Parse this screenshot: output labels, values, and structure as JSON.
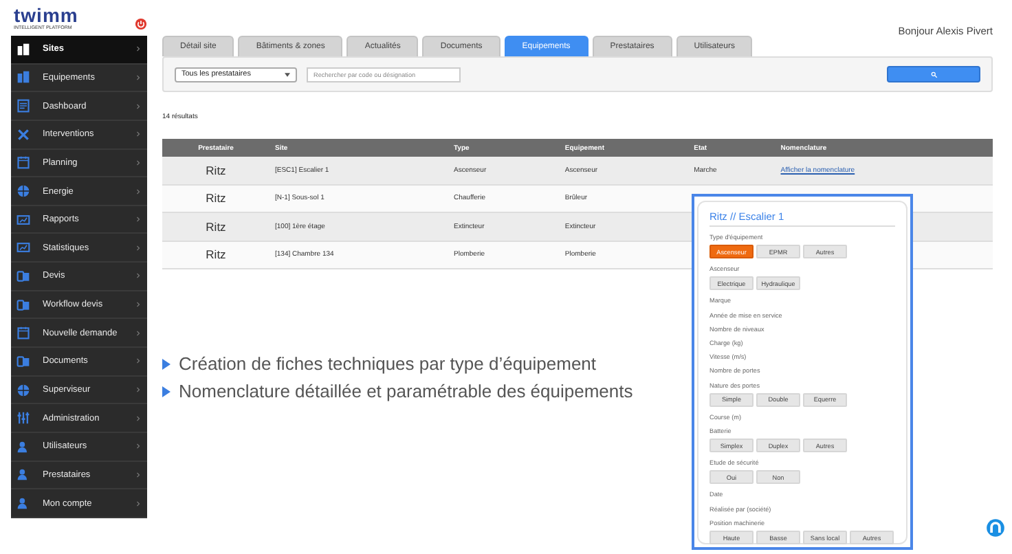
{
  "logo": {
    "name": "twimm",
    "tagline": "INTELLIGENT PLATFORM"
  },
  "sidebar": {
    "items": [
      {
        "label": "Sites",
        "selected": true
      },
      {
        "label": "Equipements",
        "selected": false
      },
      {
        "label": "Dashboard",
        "selected": false
      },
      {
        "label": "Interventions",
        "selected": false
      },
      {
        "label": "Planning",
        "selected": false
      },
      {
        "label": "Energie",
        "selected": false
      },
      {
        "label": "Rapports",
        "selected": false
      },
      {
        "label": "Statistiques",
        "selected": false
      },
      {
        "label": "Devis",
        "selected": false
      },
      {
        "label": "Workflow devis",
        "selected": false
      },
      {
        "label": "Nouvelle demande",
        "selected": false
      },
      {
        "label": "Documents",
        "selected": false
      },
      {
        "label": "Superviseur",
        "selected": false
      },
      {
        "label": "Administration",
        "selected": false
      },
      {
        "label": "Utilisateurs",
        "selected": false
      },
      {
        "label": "Prestataires",
        "selected": false
      },
      {
        "label": "Mon compte",
        "selected": false
      }
    ]
  },
  "greeting": "Bonjour Alexis Pivert",
  "tabs": [
    {
      "label": "Détail site",
      "selected": false
    },
    {
      "label": "Bâtiments & zones",
      "selected": false
    },
    {
      "label": "Actualités",
      "selected": false
    },
    {
      "label": "Documents",
      "selected": false
    },
    {
      "label": "Equipements",
      "selected": true
    },
    {
      "label": "Prestataires",
      "selected": false
    },
    {
      "label": "Utilisateurs",
      "selected": false
    }
  ],
  "filters": {
    "provider": "Tous les prestataires",
    "search_placeholder": "Rechercher par code ou désignation"
  },
  "result_count": "14 résultats",
  "table": {
    "columns": [
      "Prestataire",
      "Site",
      "Type",
      "Equipement",
      "Etat",
      "Nomenclature"
    ],
    "rows": [
      {
        "prestataire": "Ritz",
        "site": "[ESC1] Escalier 1",
        "type": "Ascenseur",
        "equipement": "Ascenseur",
        "etat": "Marche",
        "nomenclature": "Afficher la nomenclature"
      },
      {
        "prestataire": "Ritz",
        "site": "[N-1] Sous-sol 1",
        "type": "Chaufferie",
        "equipement": "Brûleur"
      },
      {
        "prestataire": "Ritz",
        "site": "[100] 1ère étage",
        "type": "Extincteur",
        "equipement": "Extincteur"
      },
      {
        "prestataire": "Ritz",
        "site": "[134] Chambre 134",
        "type": "Plomberie",
        "equipement": "Plomberie"
      }
    ]
  },
  "bullets": [
    "Création de fiches techniques par type d’équipement",
    "Nomenclature détaillée et paramétrable des équipements"
  ],
  "popup": {
    "title": "Ritz // Escalier 1",
    "fields": [
      {
        "label": "Type d'équipement",
        "options": [
          {
            "label": "Ascenseur",
            "selected": true
          },
          {
            "label": "EPMR",
            "selected": false
          },
          {
            "label": "Autres",
            "selected": false
          }
        ]
      },
      {
        "label": "Ascenseur",
        "options": [
          {
            "label": "Electrique",
            "selected": false
          },
          {
            "label": "Hydraulique",
            "selected": false
          }
        ]
      },
      {
        "label": "Marque"
      },
      {
        "label": "Année de mise en service"
      },
      {
        "label": "Nombre de niveaux"
      },
      {
        "label": "Charge (kg)"
      },
      {
        "label": "Vitesse (m/s)"
      },
      {
        "label": "Nombre de portes"
      },
      {
        "label": "Nature des portes",
        "options": [
          {
            "label": "Simple",
            "selected": false
          },
          {
            "label": "Double",
            "selected": false
          },
          {
            "label": "Equerre",
            "selected": false
          }
        ]
      },
      {
        "label": "Course (m)"
      },
      {
        "label": "Batterie",
        "options": [
          {
            "label": "Simplex",
            "selected": false
          },
          {
            "label": "Duplex",
            "selected": false
          },
          {
            "label": "Autres",
            "selected": false
          }
        ]
      },
      {
        "label": "Etude de sécurité",
        "options": [
          {
            "label": "Oui",
            "selected": false
          },
          {
            "label": "Non",
            "selected": false
          }
        ]
      },
      {
        "label": "Date"
      },
      {
        "label": "Réalisée par (société)"
      },
      {
        "label": "Position machinerie",
        "options": [
          {
            "label": "Haute",
            "selected": false
          },
          {
            "label": "Basse",
            "selected": false
          },
          {
            "label": "Sans local",
            "selected": false
          },
          {
            "label": "Autres",
            "selected": false
          }
        ]
      }
    ]
  }
}
